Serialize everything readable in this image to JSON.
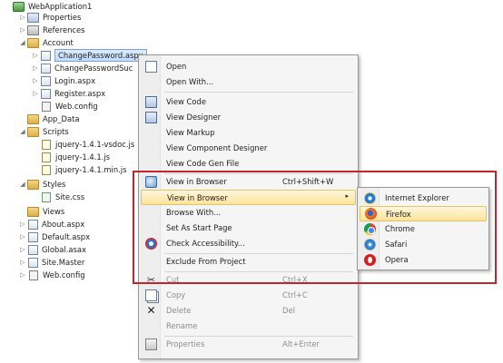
{
  "tree": {
    "project": "WebApplication1",
    "nodes": [
      {
        "label": "Properties",
        "icon": "properties-icon",
        "arrow": "▷"
      },
      {
        "label": "References",
        "icon": "references-icon",
        "arrow": "▷"
      },
      {
        "label": "Account",
        "icon": "folder-icon",
        "arrow": "◢"
      },
      {
        "label": "ChangePassword.aspx",
        "icon": "aspx-file-icon",
        "arrow": "▷"
      },
      {
        "label": "ChangePasswordSuc",
        "icon": "aspx-file-icon",
        "arrow": "▷"
      },
      {
        "label": "Login.aspx",
        "icon": "aspx-file-icon",
        "arrow": "▷"
      },
      {
        "label": "Register.aspx",
        "icon": "aspx-file-icon",
        "arrow": "▷"
      },
      {
        "label": "Web.config",
        "icon": "config-file-icon",
        "arrow": ""
      },
      {
        "label": "App_Data",
        "icon": "folder-icon",
        "arrow": ""
      },
      {
        "label": "Scripts",
        "icon": "folder-icon",
        "arrow": "◢"
      },
      {
        "label": "jquery-1.4.1-vsdoc.js",
        "icon": "js-file-icon",
        "arrow": ""
      },
      {
        "label": "jquery-1.4.1.js",
        "icon": "js-file-icon",
        "arrow": ""
      },
      {
        "label": "jquery-1.4.1.min.js",
        "icon": "js-file-icon",
        "arrow": ""
      },
      {
        "label": "Styles",
        "icon": "folder-icon",
        "arrow": "◢"
      },
      {
        "label": "Site.css",
        "icon": "css-file-icon",
        "arrow": ""
      },
      {
        "label": "Views",
        "icon": "folder-icon",
        "arrow": ""
      },
      {
        "label": "About.aspx",
        "icon": "aspx-file-icon",
        "arrow": "▷"
      },
      {
        "label": "Default.aspx",
        "icon": "aspx-file-icon",
        "arrow": "▷"
      },
      {
        "label": "Global.asax",
        "icon": "asax-file-icon",
        "arrow": "▷"
      },
      {
        "label": "Site.Master",
        "icon": "master-file-icon",
        "arrow": "▷"
      },
      {
        "label": "Web.config",
        "icon": "config-file-icon",
        "arrow": "▷"
      }
    ]
  },
  "context_menu": {
    "items": [
      {
        "label": "Open",
        "shortcut": "",
        "icon": "open-icon",
        "disabled": false
      },
      {
        "label": "Open With...",
        "shortcut": "",
        "icon": "",
        "disabled": false
      },
      {
        "label": "View Code",
        "shortcut": "",
        "icon": "code-icon",
        "disabled": false
      },
      {
        "label": "View Designer",
        "shortcut": "",
        "icon": "designer-icon",
        "disabled": false
      },
      {
        "label": "View Markup",
        "shortcut": "",
        "icon": "",
        "disabled": false
      },
      {
        "label": "View Component Designer",
        "shortcut": "",
        "icon": "",
        "disabled": false
      },
      {
        "label": "View Code Gen File",
        "shortcut": "",
        "icon": "",
        "disabled": false
      },
      {
        "label": "View in Browser",
        "shortcut": "Ctrl+Shift+W",
        "icon": "view-in-browser-icon",
        "disabled": false
      },
      {
        "label": "View in Browser",
        "shortcut": "",
        "icon": "",
        "disabled": false,
        "submenu": "▸"
      },
      {
        "label": "Browse With...",
        "shortcut": "",
        "icon": "",
        "disabled": false
      },
      {
        "label": "Set As Start Page",
        "shortcut": "",
        "icon": "",
        "disabled": false
      },
      {
        "label": "Check Accessibility...",
        "shortcut": "",
        "icon": "accessibility-icon",
        "disabled": false
      },
      {
        "label": "Exclude From Project",
        "shortcut": "",
        "icon": "",
        "disabled": false
      },
      {
        "label": "Cut",
        "shortcut": "Ctrl+X",
        "icon": "cut-icon",
        "disabled": true
      },
      {
        "label": "Copy",
        "shortcut": "Ctrl+C",
        "icon": "copy-icon",
        "disabled": true
      },
      {
        "label": "Delete",
        "shortcut": "Del",
        "icon": "delete-icon",
        "disabled": true
      },
      {
        "label": "Rename",
        "shortcut": "",
        "icon": "",
        "disabled": true
      },
      {
        "label": "Properties",
        "shortcut": "Alt+Enter",
        "icon": "properties-icon",
        "disabled": true
      }
    ]
  },
  "browser_submenu": {
    "items": [
      {
        "label": "Internet Explorer",
        "icon": "internet-explorer-icon"
      },
      {
        "label": "Firefox",
        "icon": "firefox-icon"
      },
      {
        "label": "Chrome",
        "icon": "chrome-icon"
      },
      {
        "label": "Safari",
        "icon": "safari-icon"
      },
      {
        "label": "Opera",
        "icon": "opera-icon"
      }
    ]
  },
  "colors": {
    "highlight_frame": "#c0262c",
    "menu_highlight": "#fbe49b",
    "selection": "#c1dbfc"
  }
}
